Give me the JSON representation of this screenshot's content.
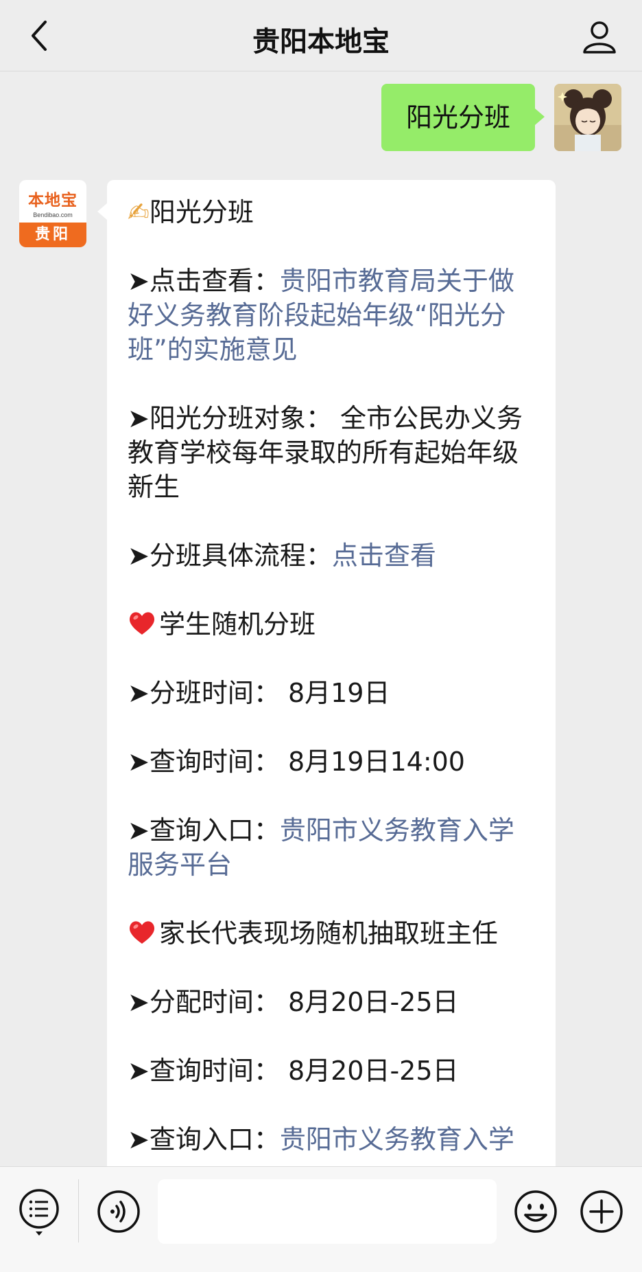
{
  "header": {
    "title": "贵阳本地宝",
    "back_icon": "chevron-left-icon",
    "profile_icon": "person-icon"
  },
  "messages": {
    "sent": {
      "text": "阳光分班"
    },
    "bot_logo": {
      "main": "本地宝",
      "sub": "Bendibao.com",
      "city": "贵阳"
    },
    "reply": {
      "heading_icon": "✍",
      "heading": "阳光分班",
      "item1_label": "➤点击查看：",
      "item1_link": "贵阳市教育局关于做好义务教育阶段起始年级“阳光分班”的实施意见",
      "item2_label": "➤阳光分班对象：",
      "item2_value": "全市公民办义务教育学校每年录取的所有起始年级新生",
      "item3_label": "➤分班具体流程：",
      "item3_link": "点击查看",
      "section2_heading": "学生随机分班",
      "item4_label": "➤分班时间：",
      "item4_value": "8月19日",
      "item5_label": "➤查询时间：",
      "item5_value": "8月19日14:00",
      "item6_label": "➤查询入口：",
      "item6_link": "贵阳市义务教育入学服务平台",
      "section3_heading": "家长代表现场随机抽取班主任",
      "item7_label": "➤分配时间：",
      "item7_value": "8月20日-25日",
      "item8_label": "➤查询时间：",
      "item8_value": "8月20日-25日",
      "item9_label": "➤查询入口：",
      "item9_link": "贵阳市义务教育入学"
    }
  },
  "input_bar": {
    "menu_icon": "menu-list-icon",
    "voice_icon": "voice-icon",
    "emoji_icon": "emoji-icon",
    "plus_icon": "plus-icon",
    "placeholder": ""
  },
  "colors": {
    "sent_bubble": "#95ec69",
    "link": "#576b95",
    "logo_orange": "#ef6b1f",
    "heart": "#e8262b"
  }
}
